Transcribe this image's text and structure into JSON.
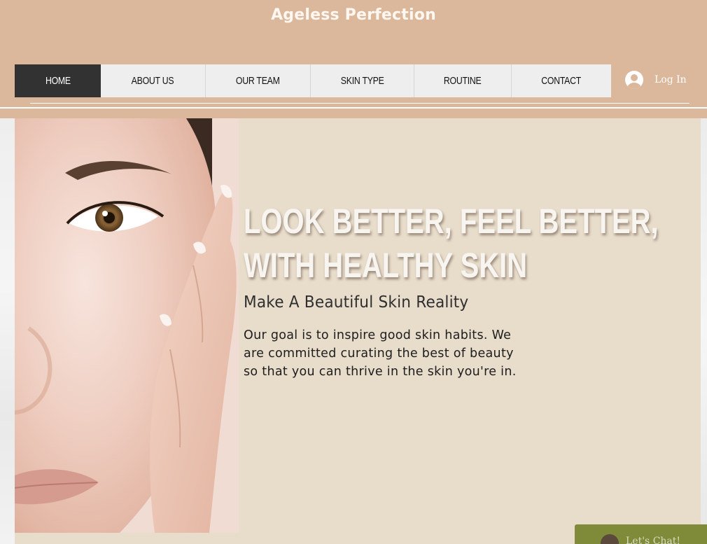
{
  "site": {
    "title": "Ageless Perfection"
  },
  "nav": {
    "items": [
      {
        "label": "HOME",
        "active": true
      },
      {
        "label": "ABOUT US",
        "active": false
      },
      {
        "label": "OUR TEAM",
        "active": false
      },
      {
        "label": "SKIN TYPE",
        "active": false
      },
      {
        "label": "ROUTINE",
        "active": false
      },
      {
        "label": "CONTACT",
        "active": false
      }
    ]
  },
  "login": {
    "label": "Log In",
    "icon": "user-avatar-icon"
  },
  "hero": {
    "heading_line1": "LOOK BETTER, FEEL BETTER,",
    "heading_line2": "WITH HEALTHY SKIN",
    "subheading": "Make A Beautiful Skin Reality",
    "body": "Our goal is to inspire good skin habits. We are committed curating the best of beauty so that you can thrive in the skin you're in."
  },
  "chat": {
    "label": "Let's Chat!",
    "icon": "chat-avatar-icon"
  },
  "colors": {
    "header_bg": "#dbb89b",
    "nav_bg": "#eeeeee",
    "nav_active_bg": "#323232",
    "hero_bg": "#e8dccb",
    "chat_bg": "#7f8b39"
  }
}
